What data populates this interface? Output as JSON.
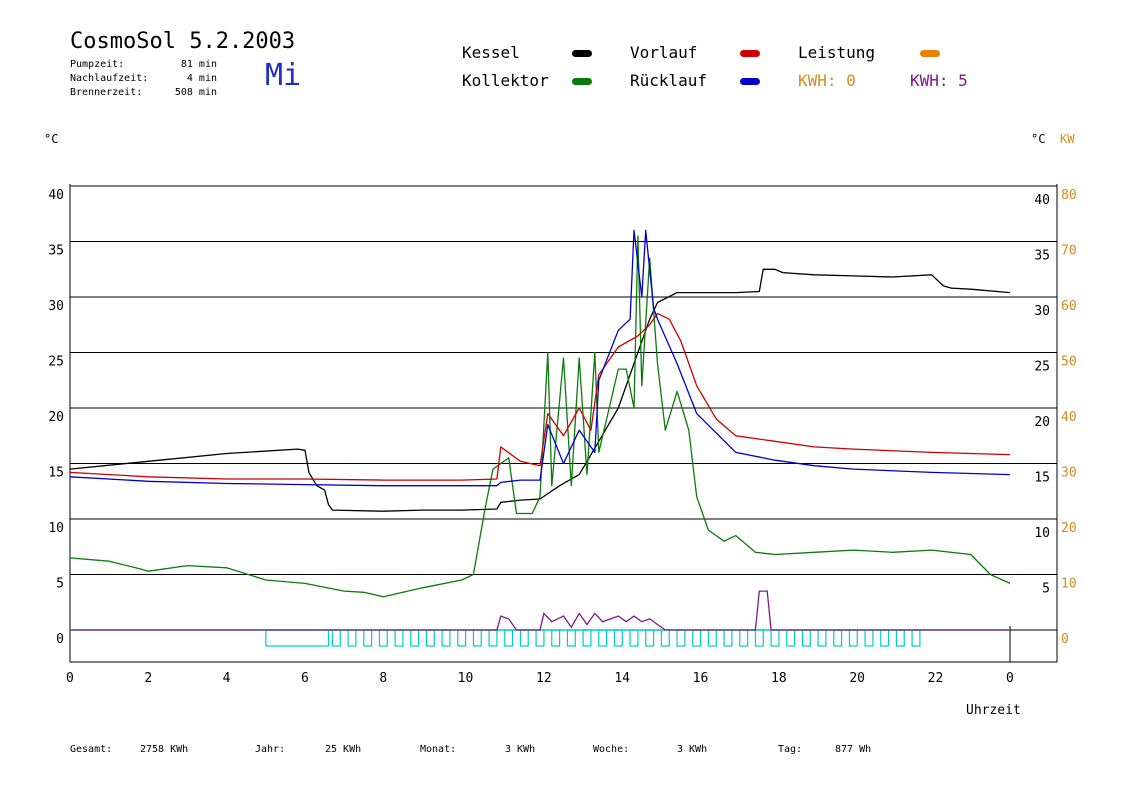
{
  "header": {
    "title": "CosmoSol 5.2.2003",
    "weekday": "Mi",
    "stats": [
      {
        "label": "Pumpzeit:",
        "value": "81 min"
      },
      {
        "label": "Nachlaufzeit:",
        "value": "4 min"
      },
      {
        "label": "Brennerzeit:",
        "value": "508 min"
      }
    ]
  },
  "legend": {
    "kessel": "Kessel",
    "kollektor": "Kollektor",
    "vorlauf": "Vorlauf",
    "ruecklauf": "Rücklauf",
    "leistung": "Leistung",
    "kwh_a": "KWH: 0",
    "kwh_b": "KWH: 5"
  },
  "units": {
    "left": "°C",
    "right_temp": "°C",
    "right_power": "KW"
  },
  "footer": [
    {
      "label": "Gesamt:",
      "value": "2758 KWh"
    },
    {
      "label": "Jahr:",
      "value": "25 KWh"
    },
    {
      "label": "Monat:",
      "value": "3 KWh"
    },
    {
      "label": "Woche:",
      "value": "3 KWh"
    },
    {
      "label": "Tag:",
      "value": "877 Wh"
    }
  ],
  "colors": {
    "kessel": "#000000",
    "kollektor": "#0a7a0a",
    "vorlauf": "#cc0000",
    "ruecklauf": "#0000cc",
    "leistung": "#ee8000",
    "kwh_a": "#d88a20",
    "kwh_b": "#7a1a8a",
    "pump": "#00cccc",
    "weekday": "#1f2fc8"
  },
  "chart_data": {
    "type": "line",
    "xlabel": "Uhrzeit",
    "xlim": [
      0,
      24
    ],
    "ylim": [
      0,
      40
    ],
    "y2lim": [
      0,
      80
    ],
    "grid": true,
    "x_ticks": [
      "0",
      "2",
      "4",
      "6",
      "8",
      "10",
      "12",
      "14",
      "16",
      "18",
      "20",
      "22",
      "0"
    ],
    "y_ticks_left": [
      "0",
      "5",
      "10",
      "15",
      "20",
      "25",
      "30",
      "35",
      "40"
    ],
    "y_ticks_right_temp": [
      "5",
      "10",
      "15",
      "20",
      "25",
      "30",
      "35",
      "40"
    ],
    "y_ticks_right_power": [
      "0",
      "10",
      "20",
      "30",
      "40",
      "50",
      "60",
      "70",
      "80"
    ],
    "series": [
      {
        "name": "Kessel",
        "color": "#000000",
        "points": [
          [
            0,
            14.5
          ],
          [
            2,
            15.2
          ],
          [
            4,
            15.9
          ],
          [
            5.8,
            16.3
          ],
          [
            6,
            16.2
          ],
          [
            6.1,
            14.2
          ],
          [
            6.3,
            13.0
          ],
          [
            6.5,
            12.6
          ],
          [
            6.6,
            11.3
          ],
          [
            6.7,
            10.8
          ],
          [
            8,
            10.7
          ],
          [
            9,
            10.8
          ],
          [
            10,
            10.8
          ],
          [
            10.9,
            10.9
          ],
          [
            11.0,
            11.5
          ],
          [
            11.5,
            11.7
          ],
          [
            12,
            11.8
          ],
          [
            12.5,
            13.0
          ],
          [
            13,
            14.0
          ],
          [
            13.5,
            17.0
          ],
          [
            14,
            20.0
          ],
          [
            14.5,
            25.0
          ],
          [
            14.8,
            28.0
          ],
          [
            15,
            29.5
          ],
          [
            15.5,
            30.4
          ],
          [
            16,
            30.4
          ],
          [
            17,
            30.4
          ],
          [
            17.6,
            30.5
          ],
          [
            17.7,
            32.5
          ],
          [
            18.0,
            32.5
          ],
          [
            18.2,
            32.2
          ],
          [
            19,
            32.0
          ],
          [
            20,
            31.9
          ],
          [
            21,
            31.8
          ],
          [
            22,
            32.0
          ],
          [
            22.3,
            31.0
          ],
          [
            22.5,
            30.8
          ],
          [
            23.0,
            30.7
          ],
          [
            24,
            30.4
          ]
        ]
      },
      {
        "name": "Kollektor",
        "color": "#0a7a0a",
        "points": [
          [
            0,
            6.5
          ],
          [
            1,
            6.2
          ],
          [
            1.8,
            5.5
          ],
          [
            2,
            5.3
          ],
          [
            3,
            5.8
          ],
          [
            4,
            5.6
          ],
          [
            5,
            4.5
          ],
          [
            6,
            4.2
          ],
          [
            7,
            3.5
          ],
          [
            7.5,
            3.4
          ],
          [
            8,
            3.0
          ],
          [
            9,
            3.8
          ],
          [
            10,
            4.5
          ],
          [
            10.3,
            5.0
          ],
          [
            10.6,
            11.0
          ],
          [
            10.8,
            14.5
          ],
          [
            11.0,
            15.0
          ],
          [
            11.2,
            15.5
          ],
          [
            11.4,
            10.5
          ],
          [
            11.8,
            10.5
          ],
          [
            12,
            12.0
          ],
          [
            12.2,
            25.0
          ],
          [
            12.3,
            13.0
          ],
          [
            12.6,
            24.5
          ],
          [
            12.8,
            13.0
          ],
          [
            13.0,
            24.5
          ],
          [
            13.2,
            14.0
          ],
          [
            13.4,
            25.0
          ],
          [
            13.5,
            16.0
          ],
          [
            14,
            23.5
          ],
          [
            14.2,
            23.5
          ],
          [
            14.4,
            20.0
          ],
          [
            14.5,
            35.5
          ],
          [
            14.6,
            22.0
          ],
          [
            14.8,
            33.5
          ],
          [
            15,
            24.0
          ],
          [
            15.2,
            18.0
          ],
          [
            15.5,
            21.5
          ],
          [
            15.8,
            18.0
          ],
          [
            16,
            12.0
          ],
          [
            16.3,
            9.0
          ],
          [
            16.7,
            8.0
          ],
          [
            17,
            8.5
          ],
          [
            17.5,
            7.0
          ],
          [
            18,
            6.8
          ],
          [
            19,
            7.0
          ],
          [
            20,
            7.2
          ],
          [
            21,
            7.0
          ],
          [
            22,
            7.2
          ],
          [
            23,
            6.8
          ],
          [
            23.5,
            5.0
          ],
          [
            24,
            4.2
          ]
        ]
      },
      {
        "name": "Vorlauf",
        "color": "#cc0000",
        "points": [
          [
            0,
            14.2
          ],
          [
            2,
            13.8
          ],
          [
            4,
            13.6
          ],
          [
            6,
            13.6
          ],
          [
            8,
            13.5
          ],
          [
            10,
            13.5
          ],
          [
            10.9,
            13.6
          ],
          [
            11.0,
            16.5
          ],
          [
            11.5,
            15.2
          ],
          [
            12,
            14.8
          ],
          [
            12.2,
            19.5
          ],
          [
            12.6,
            17.5
          ],
          [
            13,
            20.0
          ],
          [
            13.3,
            18.0
          ],
          [
            13.5,
            23.0
          ],
          [
            14,
            25.5
          ],
          [
            14.5,
            26.5
          ],
          [
            14.8,
            27.5
          ],
          [
            15,
            28.5
          ],
          [
            15.3,
            28.0
          ],
          [
            15.6,
            26.0
          ],
          [
            16,
            22.0
          ],
          [
            16.5,
            19.0
          ],
          [
            17,
            17.5
          ],
          [
            18,
            17.0
          ],
          [
            19,
            16.5
          ],
          [
            20,
            16.3
          ],
          [
            22,
            16.0
          ],
          [
            24,
            15.8
          ]
        ]
      },
      {
        "name": "Rücklauf",
        "color": "#0000cc",
        "points": [
          [
            0,
            13.8
          ],
          [
            2,
            13.4
          ],
          [
            4,
            13.2
          ],
          [
            6,
            13.1
          ],
          [
            8,
            13.0
          ],
          [
            10,
            13.0
          ],
          [
            10.9,
            13.0
          ],
          [
            11.0,
            13.3
          ],
          [
            11.5,
            13.5
          ],
          [
            12,
            13.5
          ],
          [
            12.2,
            18.5
          ],
          [
            12.6,
            15.0
          ],
          [
            13,
            18.0
          ],
          [
            13.4,
            16.0
          ],
          [
            13.5,
            22.5
          ],
          [
            14,
            27.0
          ],
          [
            14.3,
            28.0
          ],
          [
            14.4,
            36.0
          ],
          [
            14.6,
            30.0
          ],
          [
            14.7,
            36.0
          ],
          [
            14.9,
            29.0
          ],
          [
            15,
            28.0
          ],
          [
            15.5,
            24.0
          ],
          [
            16,
            19.5
          ],
          [
            17,
            16.0
          ],
          [
            18,
            15.3
          ],
          [
            19,
            14.8
          ],
          [
            20,
            14.5
          ],
          [
            22,
            14.2
          ],
          [
            24,
            14.0
          ]
        ]
      }
    ],
    "power_kw": {
      "name": "Leistung",
      "color": "#7a1a8a",
      "points": [
        [
          0,
          0
        ],
        [
          10.9,
          0
        ],
        [
          11.0,
          2.5
        ],
        [
          11.2,
          2.0
        ],
        [
          11.4,
          0
        ],
        [
          12,
          0
        ],
        [
          12.1,
          3.0
        ],
        [
          12.3,
          1.5
        ],
        [
          12.6,
          2.5
        ],
        [
          12.8,
          0.5
        ],
        [
          13,
          3.0
        ],
        [
          13.2,
          1.0
        ],
        [
          13.4,
          3.0
        ],
        [
          13.6,
          1.5
        ],
        [
          13.8,
          2.0
        ],
        [
          14,
          2.5
        ],
        [
          14.2,
          1.5
        ],
        [
          14.4,
          2.5
        ],
        [
          14.6,
          1.5
        ],
        [
          14.8,
          2.0
        ],
        [
          15,
          1.0
        ],
        [
          15.2,
          0
        ],
        [
          17.5,
          0
        ],
        [
          17.6,
          7.0
        ],
        [
          17.8,
          7.0
        ],
        [
          17.9,
          0
        ],
        [
          24,
          0
        ]
      ]
    },
    "pump_cycles": [
      [
        5,
        6.6
      ],
      [
        6.7,
        6.9
      ],
      [
        7.1,
        7.3
      ],
      [
        7.5,
        7.7
      ],
      [
        7.9,
        8.1
      ],
      [
        8.3,
        8.5
      ],
      [
        8.7,
        8.9
      ],
      [
        9.1,
        9.3
      ],
      [
        9.5,
        9.7
      ],
      [
        9.9,
        10.1
      ],
      [
        10.3,
        10.5
      ],
      [
        10.7,
        10.9
      ],
      [
        11.1,
        11.3
      ],
      [
        11.5,
        11.7
      ],
      [
        11.9,
        12.1
      ],
      [
        12.3,
        12.5
      ],
      [
        12.7,
        12.9
      ],
      [
        13.1,
        13.3
      ],
      [
        13.5,
        13.7
      ],
      [
        13.9,
        14.1
      ],
      [
        14.3,
        14.5
      ],
      [
        14.7,
        14.9
      ],
      [
        15.1,
        15.3
      ],
      [
        15.5,
        15.7
      ],
      [
        15.9,
        16.1
      ],
      [
        16.3,
        16.5
      ],
      [
        16.7,
        16.9
      ],
      [
        17.1,
        17.3
      ],
      [
        17.5,
        17.7
      ],
      [
        17.9,
        18.1
      ],
      [
        18.3,
        18.5
      ],
      [
        18.7,
        18.9
      ],
      [
        19.1,
        19.3
      ],
      [
        19.5,
        19.7
      ],
      [
        19.9,
        20.1
      ],
      [
        20.3,
        20.5
      ],
      [
        20.7,
        20.9
      ],
      [
        21.1,
        21.3
      ],
      [
        21.5,
        21.7
      ]
    ]
  }
}
